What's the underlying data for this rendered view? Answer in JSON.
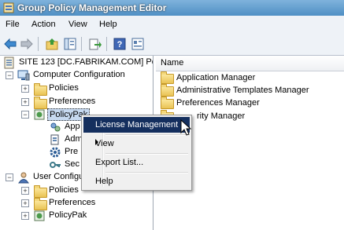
{
  "window": {
    "title": "Group Policy Management Editor"
  },
  "menubar": {
    "items": [
      "File",
      "Action",
      "View",
      "Help"
    ]
  },
  "toolbar": {
    "icons": [
      "back-arrow-icon",
      "forward-arrow-icon",
      "up-folder-icon",
      "show-hide-tree-icon",
      "export-list-icon",
      "help-icon",
      "properties-icon"
    ]
  },
  "tree": {
    "root": "SITE 123 [DC.FABRIKAM.COM] Pol",
    "computer_config": "Computer Configuration",
    "policies": "Policies",
    "preferences": "Preferences",
    "policypak": "PolicyPak",
    "app": "App",
    "adm": "Adm",
    "pre": "Pre",
    "sec": "Sec",
    "user_config": "User Configu",
    "u_policies": "Policies",
    "u_preferences": "Preferences",
    "u_policypak": "PolicyPak"
  },
  "list": {
    "column_name": "Name",
    "items": [
      "Application Manager",
      "Administrative Templates Manager",
      "Preferences Manager",
      "rity Manager"
    ]
  },
  "context_menu": {
    "items": [
      "License Management",
      "View",
      "Export List...",
      "Help"
    ],
    "highlighted": "License Management"
  },
  "colors": {
    "title_bar": "#4f8fc4",
    "menu_highlight": "#142f5e"
  }
}
